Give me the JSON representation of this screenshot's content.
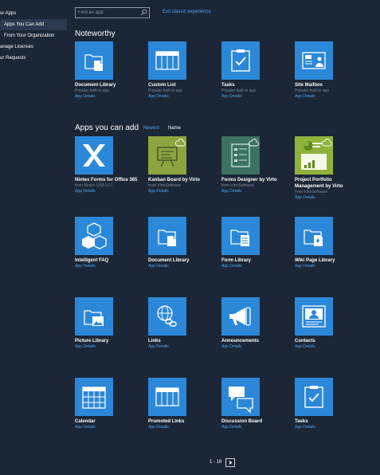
{
  "leftnav": {
    "items": [
      {
        "label": "ur Apps"
      },
      {
        "label": "Apps You Can Add"
      },
      {
        "label": "From Your Organization"
      },
      {
        "label": "anage Licenses"
      },
      {
        "label": "ur Requests"
      }
    ]
  },
  "search": {
    "placeholder": "Find an app"
  },
  "exit_link": "Exit classic experience",
  "noteworthy": {
    "heading": "Noteworthy",
    "tiles": [
      {
        "title": "Document Library",
        "sub": "Popular built-in app",
        "details": "App Details",
        "icon": "document-library-icon"
      },
      {
        "title": "Custom List",
        "sub": "Popular built-in app",
        "details": "App Details",
        "icon": "custom-list-icon"
      },
      {
        "title": "Tasks",
        "sub": "Popular built-in app",
        "details": "App Details",
        "icon": "tasks-icon"
      },
      {
        "title": "Site Mailbox",
        "sub": "Popular built-in app",
        "details": "App Details",
        "icon": "site-mailbox-icon"
      }
    ]
  },
  "apps": {
    "heading": "Apps you can add",
    "sort_newest": "Newest",
    "sort_name": "Name",
    "tiles": [
      {
        "title": "Nintex Forms for Office 365",
        "sub": "from Nintex USA LLC",
        "details": "App Details",
        "icon": "nintex-icon"
      },
      {
        "title": "Kanban Board by Virto",
        "sub": "from VirtoSoftware",
        "details": "App Details",
        "icon": "kanban-icon"
      },
      {
        "title": "Forms Designer by Virto",
        "sub": "from VirtoSoftware",
        "details": "App Details",
        "icon": "forms-designer-icon"
      },
      {
        "title": "Project Portfolio Management by Virto",
        "sub": "from VirtoSoftware",
        "details": "App Details",
        "icon": "portfolio-icon"
      },
      {
        "title": "Intelligent FAQ",
        "sub": "",
        "details": "App Details",
        "icon": "cubes-icon"
      },
      {
        "title": "Document Library",
        "sub": "",
        "details": "App Details",
        "icon": "document-library-icon"
      },
      {
        "title": "Form Library",
        "sub": "",
        "details": "App Details",
        "icon": "form-library-icon"
      },
      {
        "title": "Wiki Page Library",
        "sub": "",
        "details": "App Details",
        "icon": "wiki-library-icon"
      },
      {
        "title": "Picture Library",
        "sub": "",
        "details": "App Details",
        "icon": "picture-library-icon"
      },
      {
        "title": "Links",
        "sub": "",
        "details": "App Details",
        "icon": "links-icon"
      },
      {
        "title": "Announcements",
        "sub": "",
        "details": "App Details",
        "icon": "announcements-icon"
      },
      {
        "title": "Contacts",
        "sub": "",
        "details": "App Details",
        "icon": "contacts-icon"
      },
      {
        "title": "Calendar",
        "sub": "",
        "details": "App Details",
        "icon": "calendar-icon"
      },
      {
        "title": "Promoted Links",
        "sub": "",
        "details": "App Details",
        "icon": "promoted-links-icon"
      },
      {
        "title": "Discussion Board",
        "sub": "",
        "details": "App Details",
        "icon": "discussion-icon"
      },
      {
        "title": "Tasks",
        "sub": "",
        "details": "App Details",
        "icon": "tasks-icon"
      }
    ]
  },
  "pager": {
    "label": "1 - 16"
  },
  "colors": {
    "accent": "#2b88d8",
    "link": "#4ea6ee",
    "background": "#1b2636"
  }
}
